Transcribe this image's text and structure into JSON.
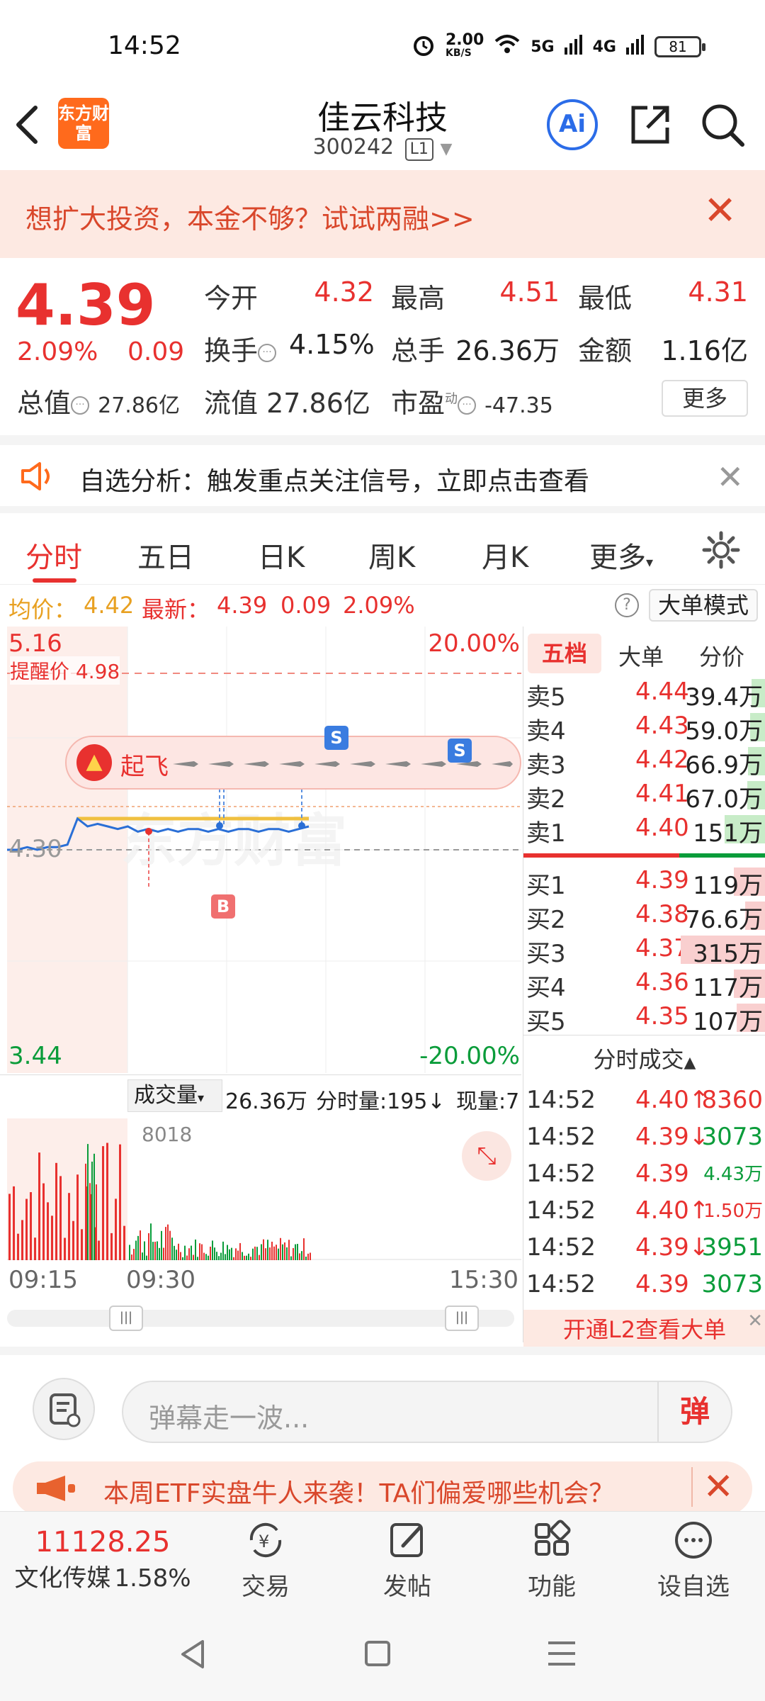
{
  "status_bar": {
    "time": "14:52",
    "net_speed": "2.00",
    "net_unit": "KB/S",
    "signal1": "5G",
    "signal2": "4G",
    "battery": "81"
  },
  "header": {
    "logo_text": "东方财富",
    "stock_name": "佳云科技",
    "stock_code": "300242",
    "level_badge": "L1",
    "ai_label": "Ai"
  },
  "promo": {
    "text": "想扩大投资，本金不够？试试两融>>"
  },
  "quote": {
    "price": "4.39",
    "change_pct": "2.09%",
    "change": "0.09",
    "open_label": "今开",
    "open": "4.32",
    "high_label": "最高",
    "high": "4.51",
    "low_label": "最低",
    "low": "4.31",
    "turnover_label": "换手",
    "turnover": "4.15%",
    "volume_label": "总手",
    "volume": "26.36万",
    "amount_label": "金额",
    "amount": "1.16亿",
    "mktcap_label": "总值",
    "mktcap": "27.86亿",
    "float_label": "流值",
    "float": "27.86亿",
    "pe_label": "市盈",
    "pe_sup": "动",
    "pe": "-47.35",
    "more_button": "更多"
  },
  "analysis": {
    "text": "自选分析：触发重点关注信号，立即点击查看"
  },
  "tabs": [
    "分时",
    "五日",
    "日K",
    "周K",
    "月K",
    "更多"
  ],
  "avg_row": {
    "avg_label": "均价：",
    "avg": "4.42",
    "latest_label": "最新：",
    "latest": "4.39",
    "latest_chg": "0.09",
    "latest_pct": "2.09%",
    "mode_button": "大单模式"
  },
  "chart": {
    "top_price": "5.16",
    "top_pct": "20.00%",
    "base_price": "4.30",
    "bottom_price": "3.44",
    "bottom_pct": "-20.00%",
    "alert_label": "提醒价 4.98",
    "takeoff_label": "起飞",
    "marker_s": "S",
    "marker_b": "B",
    "watermark": "东方财富"
  },
  "chart_data": {
    "type": "line",
    "ylim": [
      3.44,
      5.16
    ],
    "series": [
      {
        "values": [
          4.3,
          4.3,
          4.31,
          4.3,
          4.31,
          4.31,
          4.32,
          4.42,
          4.39,
          4.4,
          4.39,
          4.38,
          4.39,
          4.37,
          4.38,
          4.37,
          4.38,
          4.37,
          4.38,
          4.38,
          4.37,
          4.38,
          4.37,
          4.38,
          4.38,
          4.37,
          4.38,
          4.38,
          4.37,
          4.38,
          4.39
        ]
      },
      {
        "values": [
          null,
          null,
          null,
          null,
          null,
          null,
          null,
          4.42,
          4.42,
          4.42,
          4.42,
          4.42,
          4.42,
          4.42,
          4.42,
          4.42,
          4.42,
          4.42,
          4.42,
          4.42,
          4.42,
          4.42,
          4.42,
          4.42,
          4.42,
          4.42,
          4.42,
          4.42,
          4.42,
          4.42,
          4.42
        ]
      }
    ]
  },
  "volume_header": {
    "selector": "成交量",
    "total": "26.36万",
    "tick_label": "分时量:195",
    "current_label": "现量:7",
    "peak": "8018"
  },
  "time_axis": [
    "09:15",
    "09:30",
    "15:30"
  ],
  "order_book": {
    "tabs": [
      "五档",
      "大单",
      "分价"
    ],
    "asks": [
      {
        "label": "卖5",
        "price": "4.44",
        "vol": "39.4万"
      },
      {
        "label": "卖4",
        "price": "4.43",
        "vol": "59.0万"
      },
      {
        "label": "卖3",
        "price": "4.42",
        "vol": "66.9万"
      },
      {
        "label": "卖2",
        "price": "4.41",
        "vol": "67.0万"
      },
      {
        "label": "卖1",
        "price": "4.40",
        "vol": "151万"
      }
    ],
    "bids": [
      {
        "label": "买1",
        "price": "4.39",
        "vol": "119万"
      },
      {
        "label": "买2",
        "price": "4.38",
        "vol": "76.6万"
      },
      {
        "label": "买3",
        "price": "4.37",
        "vol": "315万"
      },
      {
        "label": "买4",
        "price": "4.36",
        "vol": "117万"
      },
      {
        "label": "买5",
        "price": "4.35",
        "vol": "107万"
      }
    ],
    "ticks_title": "分时成交",
    "ticks": [
      {
        "time": "14:52",
        "price": "4.40",
        "dir": "↑",
        "vol": "8360"
      },
      {
        "time": "14:52",
        "price": "4.39",
        "dir": "↓",
        "vol": "3073"
      },
      {
        "time": "14:52",
        "price": "4.39",
        "dir": "",
        "vol": "4.43万"
      },
      {
        "time": "14:52",
        "price": "4.40",
        "dir": "↑",
        "vol": "1.50万"
      },
      {
        "time": "14:52",
        "price": "4.39",
        "dir": "↓",
        "vol": "3951"
      },
      {
        "time": "14:52",
        "price": "4.39",
        "dir": "",
        "vol": "3073"
      }
    ],
    "l2_label": "开通L2查看大单"
  },
  "comment": {
    "placeholder": "弹幕走一波...",
    "send": "弹"
  },
  "etf_banner": {
    "text": "本周ETF实盘牛人来袭！TA们偏爱哪些机会？"
  },
  "bottom_nav": {
    "index_value": "11128.25",
    "index_name": "文化传媒",
    "index_pct": "1.58%",
    "items": [
      "交易",
      "发帖",
      "功能",
      "设自选"
    ]
  }
}
